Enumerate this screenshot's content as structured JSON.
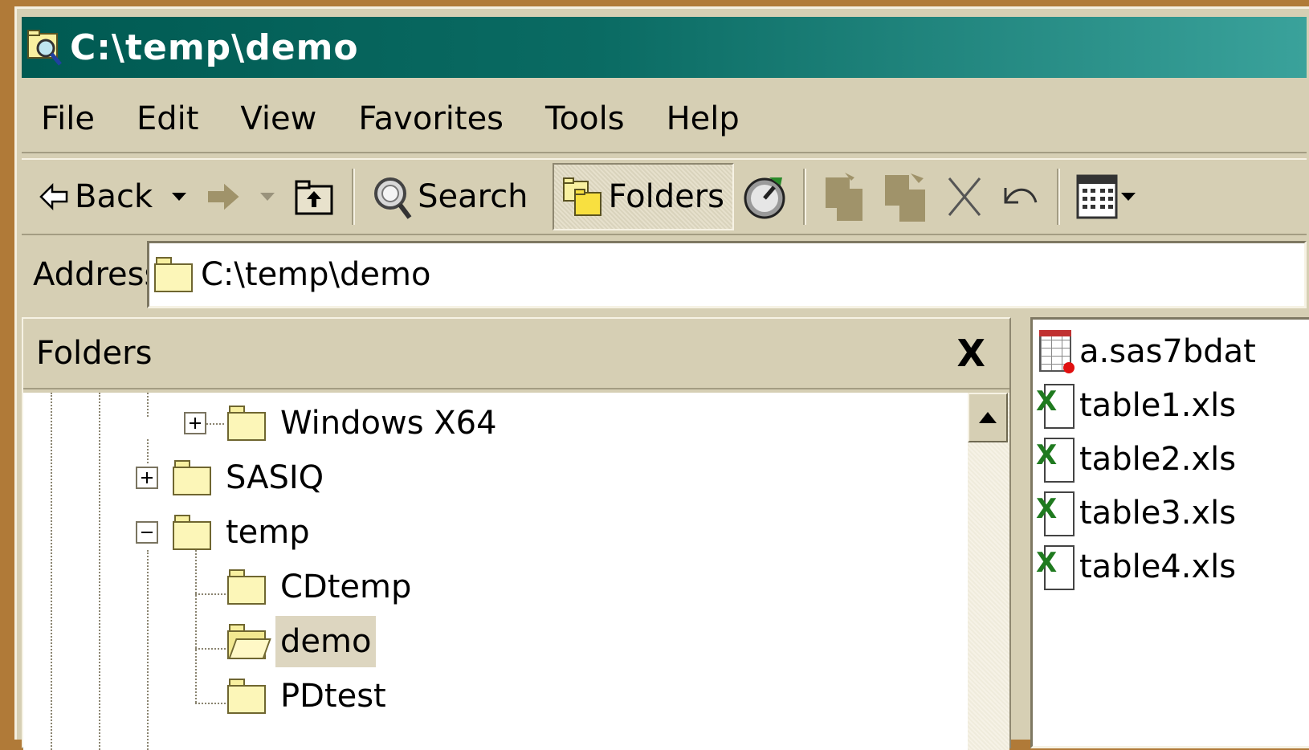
{
  "window": {
    "title": "C:\\temp\\demo"
  },
  "menu": {
    "items": [
      "File",
      "Edit",
      "View",
      "Favorites",
      "Tools",
      "Help"
    ]
  },
  "toolbar": {
    "back_label": "Back",
    "search_label": "Search",
    "folders_label": "Folders"
  },
  "address": {
    "label": "Address",
    "value": "C:\\temp\\demo"
  },
  "folders_pane": {
    "title": "Folders",
    "close_glyph": "X",
    "tree": [
      {
        "label": "Windows X64",
        "expander": "plus"
      },
      {
        "label": "SASIQ",
        "expander": "plus"
      },
      {
        "label": "temp",
        "expander": "minus"
      },
      {
        "label": "CDtemp",
        "expander": "none"
      },
      {
        "label": "demo",
        "expander": "none",
        "selected": true
      },
      {
        "label": "PDtest",
        "expander": "none"
      }
    ]
  },
  "files": [
    {
      "name": "a.sas7bdat",
      "icon": "sas-dataset-icon"
    },
    {
      "name": "table1.xls",
      "icon": "excel-file-icon"
    },
    {
      "name": "table2.xls",
      "icon": "excel-file-icon"
    },
    {
      "name": "table3.xls",
      "icon": "excel-file-icon"
    },
    {
      "name": "table4.xls",
      "icon": "excel-file-icon"
    }
  ],
  "colors": {
    "titlebar_start": "#005a52",
    "titlebar_end": "#3aa29b",
    "chrome": "#d6cfb4",
    "desktop": "#b07a38"
  }
}
